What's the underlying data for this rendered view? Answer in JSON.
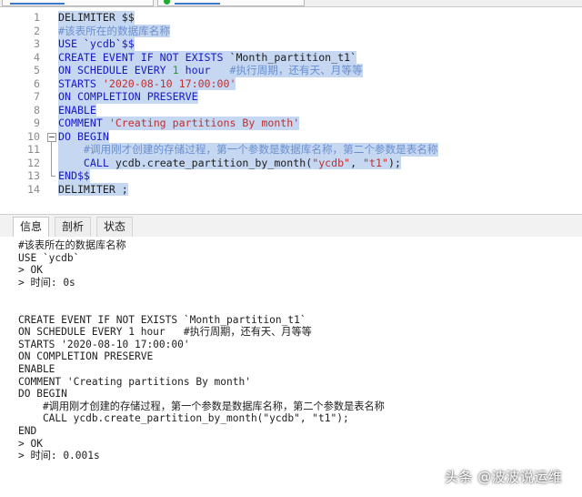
{
  "editor": {
    "line_numbers": [
      "1",
      "2",
      "3",
      "4",
      "5",
      "6",
      "7",
      "8",
      "9",
      "10",
      "11",
      "12",
      "13",
      "14"
    ],
    "lines": [
      [
        {
          "t": "DELIMITER $$",
          "c": "pl"
        }
      ],
      [
        {
          "t": "#该表所在的数据库名称",
          "c": "cm"
        }
      ],
      [
        {
          "t": "USE `ycdb`$$",
          "c": "kw"
        }
      ],
      [
        {
          "t": "CREATE EVENT IF NOT EXISTS ",
          "c": "kw"
        },
        {
          "t": "`Month_partition_t1`",
          "c": "pl"
        }
      ],
      [
        {
          "t": "ON SCHEDULE EVERY ",
          "c": "kw"
        },
        {
          "t": "1",
          "c": "num"
        },
        {
          "t": " hour",
          "c": "kw"
        },
        {
          "t": "   #执行周期，还有天、月等等",
          "c": "cm"
        }
      ],
      [
        {
          "t": "STARTS ",
          "c": "kw"
        },
        {
          "t": "'2020-08-10 17:00:00'",
          "c": "str"
        }
      ],
      [
        {
          "t": "ON COMPLETION PRESERVE",
          "c": "kw"
        }
      ],
      [
        {
          "t": "ENABLE",
          "c": "kw"
        }
      ],
      [
        {
          "t": "COMMENT ",
          "c": "kw"
        },
        {
          "t": "'Creating partitions By month'",
          "c": "str"
        }
      ],
      [
        {
          "t": "DO BEGIN",
          "c": "kw"
        }
      ],
      [
        {
          "t": "    #调用刚才创建的存储过程，第一个参数是数据库名称，第二个参数是表名称",
          "c": "cm"
        }
      ],
      [
        {
          "t": "    CALL ",
          "c": "kw"
        },
        {
          "t": "ycdb.create_partition_by_month(",
          "c": "pl"
        },
        {
          "t": "\"ycdb\"",
          "c": "str"
        },
        {
          "t": ", ",
          "c": "pl"
        },
        {
          "t": "\"t1\"",
          "c": "str"
        },
        {
          "t": ");",
          "c": "pl"
        }
      ],
      [
        {
          "t": "END$$",
          "c": "kw"
        }
      ],
      [
        {
          "t": "DELIMITER ;",
          "c": "pl"
        }
      ]
    ]
  },
  "panel_tabs": [
    {
      "label": "信息",
      "active": true
    },
    {
      "label": "剖析",
      "active": false
    },
    {
      "label": "状态",
      "active": false
    }
  ],
  "output": {
    "lines": [
      "#该表所在的数据库名称",
      "USE `ycdb`",
      "> OK",
      "> 时间: 0s",
      "",
      "",
      "CREATE EVENT IF NOT EXISTS `Month_partition_t1`",
      "ON SCHEDULE EVERY 1 hour   #执行周期，还有天、月等等",
      "STARTS '2020-08-10 17:00:00'",
      "ON COMPLETION PRESERVE",
      "ENABLE",
      "COMMENT 'Creating partitions By month'",
      "DO BEGIN",
      "    #调用刚才创建的存储过程，第一个参数是数据库名称，第二个参数是表名称",
      "    CALL ycdb.create_partition_by_month(\"ycdb\", \"t1\");",
      "END",
      "> OK",
      "> 时间: 0.001s"
    ]
  },
  "watermark": "头条 @波波说运维",
  "colors": {
    "selection": "#c5d7f1",
    "keyword": "#1818c8",
    "comment": "#6a8fcf",
    "string": "#c03030",
    "number": "#22a022"
  }
}
